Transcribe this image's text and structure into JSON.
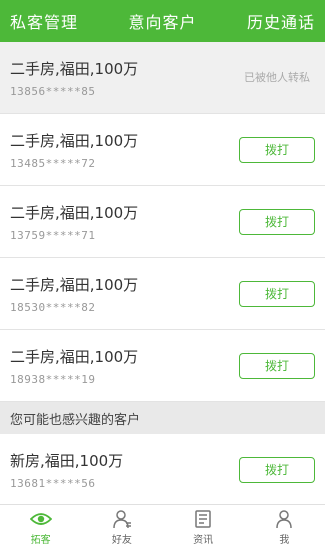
{
  "colors": {
    "accent": "#4db839"
  },
  "tabs": [
    "私客管理",
    "意向客户",
    "历史通话"
  ],
  "rows": [
    {
      "title": "二手房,福田,100万",
      "phone": "13856*****85",
      "status": "已被他人转私"
    },
    {
      "title": "二手房,福田,100万",
      "phone": "13485*****72",
      "action": "拨打"
    },
    {
      "title": "二手房,福田,100万",
      "phone": "13759*****71",
      "action": "拨打"
    },
    {
      "title": "二手房,福田,100万",
      "phone": "18530*****82",
      "action": "拨打"
    },
    {
      "title": "二手房,福田,100万",
      "phone": "18938*****19",
      "action": "拨打"
    }
  ],
  "section": {
    "title": "您可能也感兴趣的客户"
  },
  "recommend": [
    {
      "title": "新房,福田,100万",
      "phone": "13681*****56",
      "action": "拨打"
    }
  ],
  "bottom_nav": [
    {
      "label": "拓客",
      "icon": "eye-icon",
      "active": true
    },
    {
      "label": "好友",
      "icon": "user-icon",
      "active": false
    },
    {
      "label": "资讯",
      "icon": "news-icon",
      "active": false
    },
    {
      "label": "我",
      "icon": "person-icon",
      "active": false
    }
  ]
}
